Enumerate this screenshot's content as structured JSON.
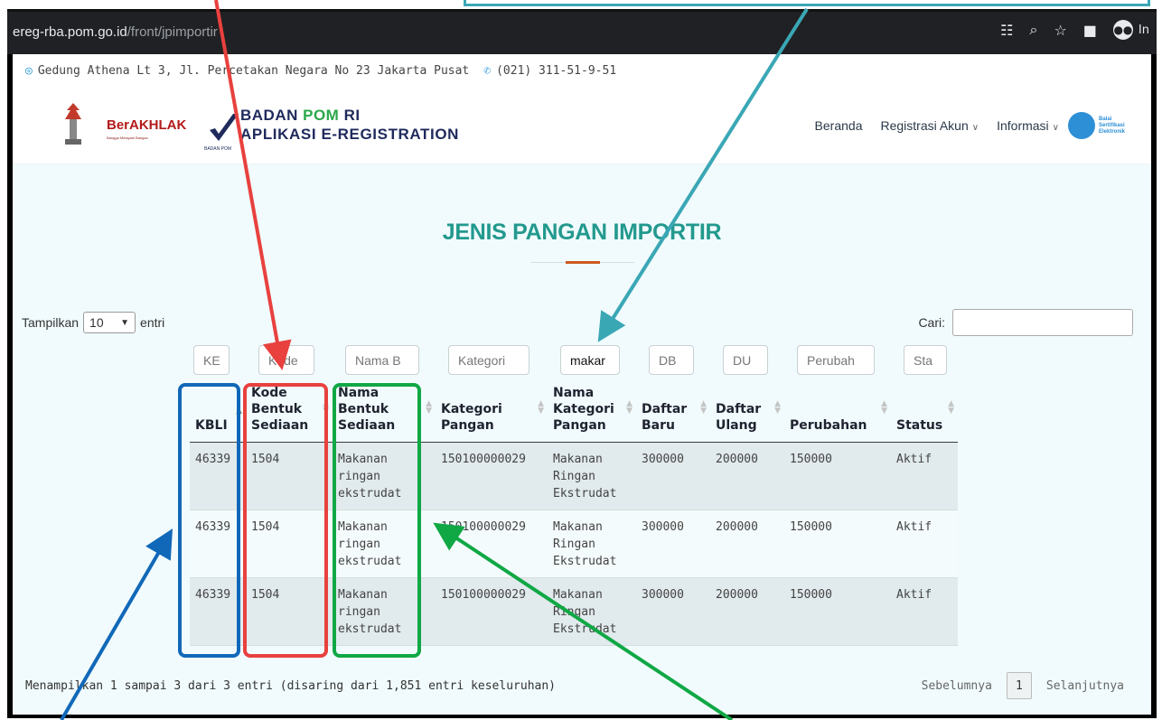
{
  "browser": {
    "url_domain": "ereg-rba.pom.go.id",
    "url_path": "/front/jpimportir",
    "profile_label": "In"
  },
  "topbar": {
    "address": "Gedung Athena Lt 3, Jl. Percetakan Negara No 23 Jakarta Pusat",
    "phone": "(021) 311-51-9-51"
  },
  "header": {
    "berakhlak": "BerAKHLAK",
    "berakhlak_sub": "Bangga Melayani Bangsa",
    "pom_small": "BADAN POM",
    "brand_part1": "BADAN ",
    "brand_part2": "POM",
    "brand_part3": " RI",
    "brand_line2": "APLIKASI E-REGISTRATION",
    "bse_text": "Balai Sertifikasi Elektronik"
  },
  "nav": {
    "home": "Beranda",
    "register": "Registrasi Akun",
    "info": "Informasi"
  },
  "page": {
    "title": "JENIS PANGAN IMPORTIR"
  },
  "controls": {
    "show_label": "Tampilkan",
    "show_value": "10",
    "entries_label": "entri",
    "search_label": "Cari:"
  },
  "filters": {
    "kbli": "KE",
    "kode": "Kode",
    "nama_bentuk": "Nama B",
    "kategori": "Kategori",
    "nama_kategori": "makar",
    "db": "DB",
    "du": "DU",
    "perubahan": "Perubah",
    "status": "Sta"
  },
  "table": {
    "headers": {
      "kbli": "KBLI",
      "kode_a": "Kode",
      "kode_b": "Bentuk",
      "kode_c": "Sediaan",
      "nama_a": "Nama",
      "nama_b": "Bentuk",
      "nama_c": "Sediaan",
      "kat_a": "Kategori",
      "kat_b": "Pangan",
      "nk_a": "Nama",
      "nk_b": "Kategori",
      "nk_c": "Pangan",
      "db_a": "Daftar",
      "db_b": "Baru",
      "du_a": "Daftar",
      "du_b": "Ulang",
      "perubahan": "Perubahan",
      "status": "Status"
    },
    "rows": [
      {
        "kbli": "46339",
        "kode": "1504",
        "nama_a": "Makanan",
        "nama_b": "ringan",
        "nama_c": "ekstrudat",
        "kategori": "150100000029",
        "nk_a": "Makanan",
        "nk_b": "Ringan",
        "nk_c": "Ekstrudat",
        "db": "300000",
        "du": "200000",
        "perubahan": "150000",
        "status": "Aktif"
      },
      {
        "kbli": "46339",
        "kode": "1504",
        "nama_a": "Makanan",
        "nama_b": "ringan",
        "nama_c": "ekstrudat",
        "kategori": "150100000029",
        "nk_a": "Makanan",
        "nk_b": "Ringan",
        "nk_c": "Ekstrudat",
        "db": "300000",
        "du": "200000",
        "perubahan": "150000",
        "status": "Aktif"
      },
      {
        "kbli": "46339",
        "kode": "1504",
        "nama_a": "Makanan",
        "nama_b": "ringan",
        "nama_c": "ekstrudat",
        "kategori": "150100000029",
        "nk_a": "Makanan",
        "nk_b": "Ringan",
        "nk_c": "Ekstrudat",
        "db": "300000",
        "du": "200000",
        "perubahan": "150000",
        "status": "Aktif"
      }
    ]
  },
  "footer": {
    "info": "Menampilkan 1 sampai 3 dari 3 entri (disaring dari 1,851 entri keseluruhan)",
    "prev": "Sebelumnya",
    "page": "1",
    "next": "Selanjutnya"
  },
  "colors": {
    "title_teal": "#23998e",
    "accent_orange": "#cb5a1d",
    "annot_red": "#e8413e",
    "annot_blue": "#1168b8",
    "annot_green": "#10a845",
    "annot_teal": "#3aa7b5"
  }
}
